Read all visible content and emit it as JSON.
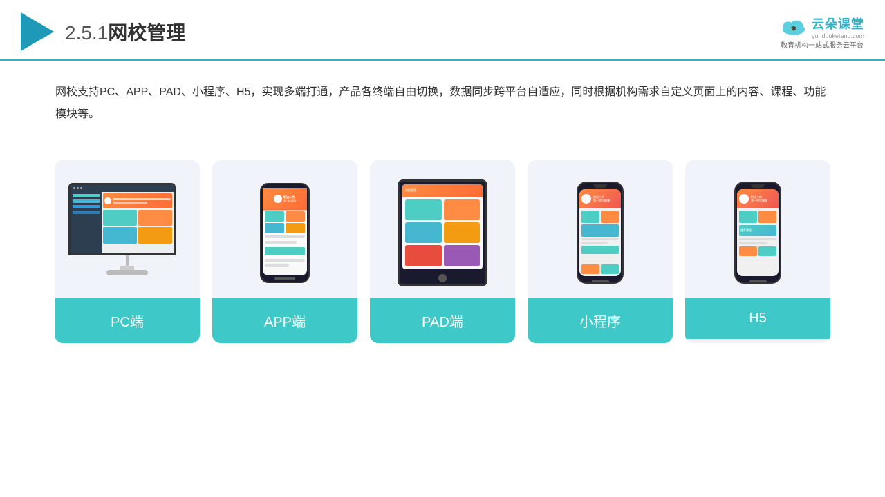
{
  "header": {
    "title_number": "2.5.1",
    "title_text": "网校管理",
    "brand_name": "云朵课堂",
    "brand_url": "yunduoketang.com",
    "brand_tagline": "教育机构一站\n式服务云平台"
  },
  "description": {
    "text": "网校支持PC、APP、PAD、小程序、H5，实现多端打通，产品各终端自由切换，数据同步跨平台自适应，同时根据机构需求自定义页面上的内容、课程、功能模块等。"
  },
  "cards": [
    {
      "id": "pc",
      "label": "PC端"
    },
    {
      "id": "app",
      "label": "APP端"
    },
    {
      "id": "pad",
      "label": "PAD端"
    },
    {
      "id": "miniprogram",
      "label": "小程序"
    },
    {
      "id": "h5",
      "label": "H5"
    }
  ],
  "colors": {
    "accent": "#2bb5c8",
    "card_bg": "#f0f4fa",
    "card_label_bg": "#3ec8c8",
    "header_border": "#2bb5c8"
  }
}
